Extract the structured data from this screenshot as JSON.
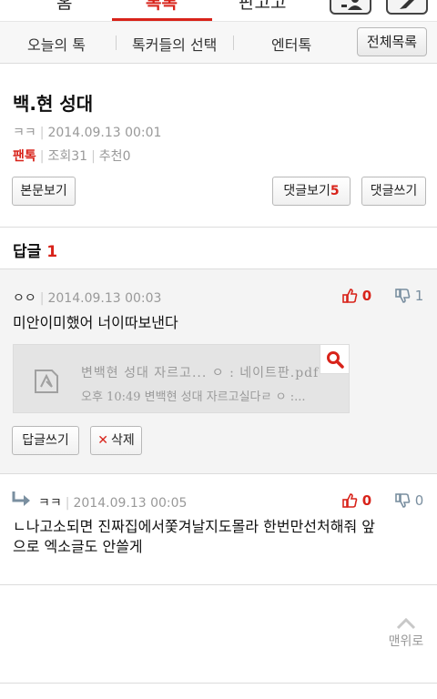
{
  "top_tabs": [
    {
      "label": "홈"
    },
    {
      "label": "톡톡"
    },
    {
      "label": "판고고"
    }
  ],
  "subnav": {
    "items": [
      "오늘의 톡",
      "톡커들의 선택",
      "엔터톡"
    ],
    "all_button": "전체목록"
  },
  "article": {
    "title": "백.현 성대",
    "author": "ㅋㅋ",
    "datetime": "2014.09.13 00:01",
    "category": "팬톡",
    "views_label": "조회",
    "views": "31",
    "recommend_label": "추천",
    "recommend": "0",
    "view_body_button": "본문보기",
    "view_comments_label": "댓글보기",
    "comment_count": "5",
    "write_comment_button": "댓글쓰기"
  },
  "replies": {
    "label": "답글",
    "count": "1"
  },
  "comments": [
    {
      "author": "ㅇㅇ",
      "datetime": "2014.09.13 00:03",
      "up": "0",
      "down": "1",
      "text": "미안이미했어 너이따보낸다",
      "attachment": {
        "line1": "변백현 성대 자르고... ㅇ : 네이트판.pdf",
        "line2": "오후 10:49       변백현 성대 자르고실다ㄹ ㅇ :..."
      },
      "reply_button": "답글쓰기",
      "delete_button": "삭제"
    },
    {
      "author": "ㅋㅋ",
      "datetime": "2014.09.13 00:05",
      "up": "0",
      "down": "0",
      "text_line1": "ㄴ나고소되면 진짜집에서쫓겨날지도몰라 한번만선처해줘 앞",
      "text_line2": "으로 엑소글도 안쓸게"
    }
  ],
  "scroll_top": {
    "label": "맨위로"
  },
  "colors": {
    "accent": "#d8231a",
    "down_vote": "#7a8fa0",
    "muted_text": "#999999"
  }
}
